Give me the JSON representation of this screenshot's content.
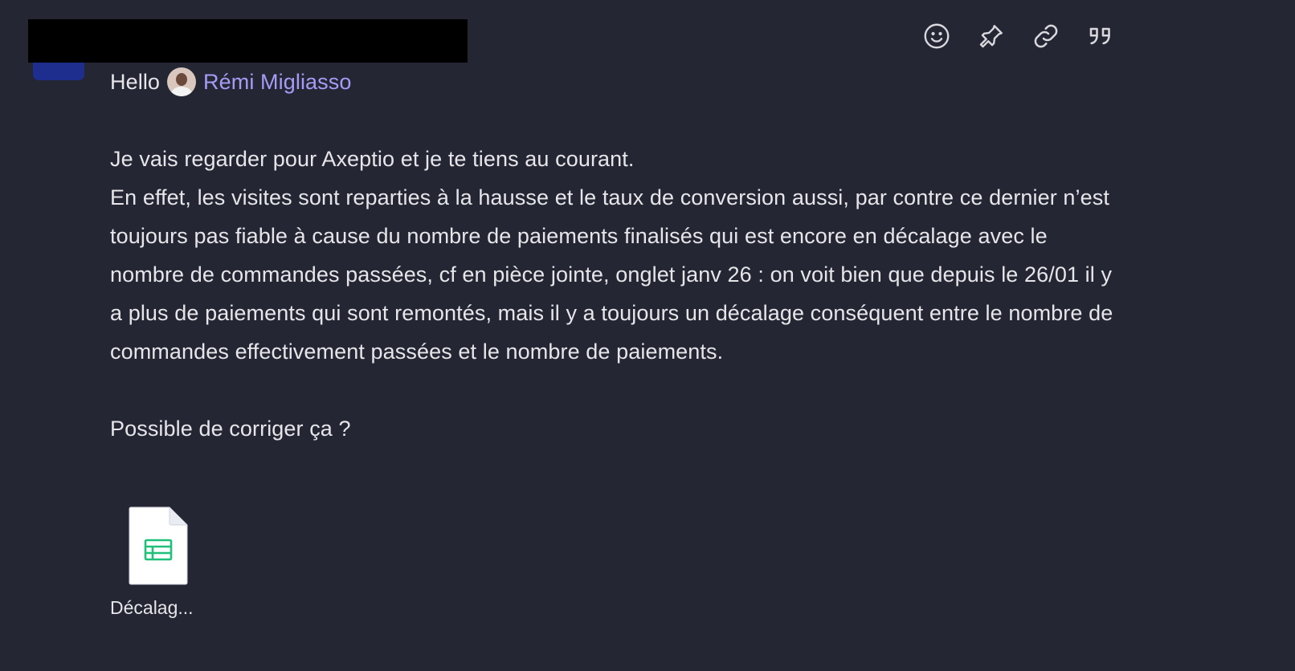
{
  "message": {
    "greeting": "Hello",
    "mention_name": "Rémi Migliasso",
    "lines": [
      "Je vais regarder pour Axeptio et je te tiens au courant.",
      "En effet, les visites sont reparties à la hausse et le taux de conversion aussi, par contre ce dernier n’est toujours pas fiable à cause du nombre de paiements finalisés qui est encore en décalage avec le nombre de commandes passées, cf en pièce jointe, onglet janv 26 : on voit bien que depuis le 26/01 il y a plus de paiements qui sont remontés, mais il y a toujours un décalage conséquent entre le nombre de commandes effectivement passées et le nombre de paiements."
    ],
    "question": "Possible de corriger ça ?"
  },
  "attachment": {
    "name": "Décalag...",
    "icon": "spreadsheet-file-icon",
    "accent": "#21c07a"
  },
  "actions": [
    {
      "icon": "emoji-icon"
    },
    {
      "icon": "pin-icon"
    },
    {
      "icon": "link-icon"
    },
    {
      "icon": "quote-icon"
    }
  ],
  "colors": {
    "background": "#242633",
    "text": "#e6e6ea",
    "mention": "#a59cf5",
    "avatar": "#1e2e8f"
  }
}
